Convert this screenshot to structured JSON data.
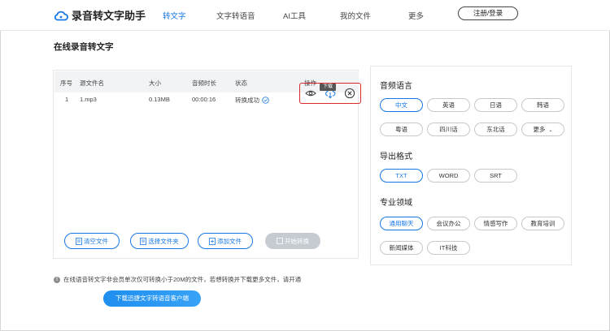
{
  "header": {
    "app_name": "录音转文字助手",
    "nav": [
      {
        "label": "转文字",
        "active": true
      },
      {
        "label": "文字转语音",
        "active": false
      },
      {
        "label": "AI工具",
        "active": false
      },
      {
        "label": "我的文件",
        "active": false
      },
      {
        "label": "更多",
        "active": false
      }
    ],
    "login_label": "注册/登录",
    "accent_color": "#1677e5"
  },
  "page_title": "在线录音转文字",
  "file_table": {
    "columns": [
      "序号",
      "源文件名",
      "大小",
      "音频时长",
      "状态",
      "操作"
    ],
    "rows": [
      {
        "index": "1",
        "filename": "1.mp3",
        "size": "0.13MB",
        "duration": "00:00:16",
        "status": "转换成功",
        "actions": [
          "eye-icon",
          "download-icon",
          "close-circle-icon"
        ]
      }
    ],
    "tooltip": "下载"
  },
  "actions": {
    "clear": "清空文件",
    "choose_folder": "选择文件夹",
    "add_file": "添加文件",
    "start": "开始转换"
  },
  "settings": {
    "audio_language": {
      "title": "音频语言",
      "options": [
        "中文",
        "英语",
        "日语",
        "韩语",
        "粤语",
        "四川话",
        "东北话",
        "更多"
      ],
      "selected": "中文"
    },
    "export_format": {
      "title": "导出格式",
      "options": [
        "TXT",
        "WORD",
        "SRT"
      ],
      "selected": "TXT"
    },
    "domain": {
      "title": "专业领域",
      "options": [
        "通用聊天",
        "会议办公",
        "情感写作",
        "教育培训",
        "新闻媒体",
        "IT科技"
      ],
      "selected": "通用聊天"
    }
  },
  "notice": "在线语音转文字非会员单次仅可转换小于20M的文件，若想转换并下载更多文件，请开通",
  "download_client": "下载迅捷文字转语音客户端",
  "colors": {
    "highlight_box": "#d9292b",
    "success": "#1677e5"
  }
}
